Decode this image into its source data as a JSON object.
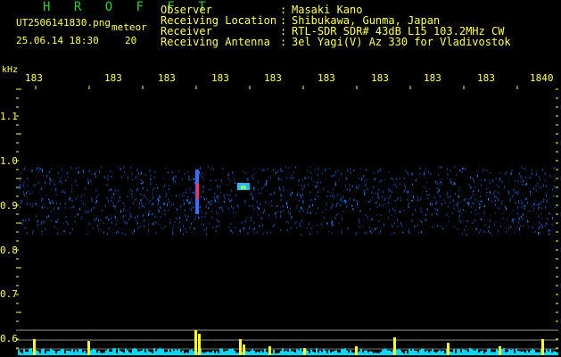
{
  "app": {
    "name": "H R O F F T",
    "filename": "UT2506141830.png",
    "tag": "meteor",
    "datetime": "25.06.14 18:30",
    "counter": "20"
  },
  "info": [
    {
      "label": "Observer",
      "value": "Masaki Kano"
    },
    {
      "label": "Receiving Location",
      "value": "Shibukawa, Gunma, Japan"
    },
    {
      "label": "Receiver",
      "value": "RTL-SDR SDR# 43dB L15 103.2MHz CW"
    },
    {
      "label": "Receiving Antenna",
      "value": "3el Yagi(V) Az 330 for Vladivostok"
    }
  ],
  "axis": {
    "y_unit": "kHz",
    "y_ticks": [
      "1.1",
      "1.0",
      "0.9",
      "0.8",
      "0.7",
      "0.6"
    ],
    "x_ticks": [
      "183",
      "183",
      "183",
      "183",
      "183",
      "183",
      "183",
      "183",
      "183",
      "1840"
    ]
  },
  "colors": {
    "background": "#000000",
    "text": "#ffff66",
    "title": "#33cc33",
    "signal": "#1f6fe0",
    "baseline": "#00ffff"
  }
}
